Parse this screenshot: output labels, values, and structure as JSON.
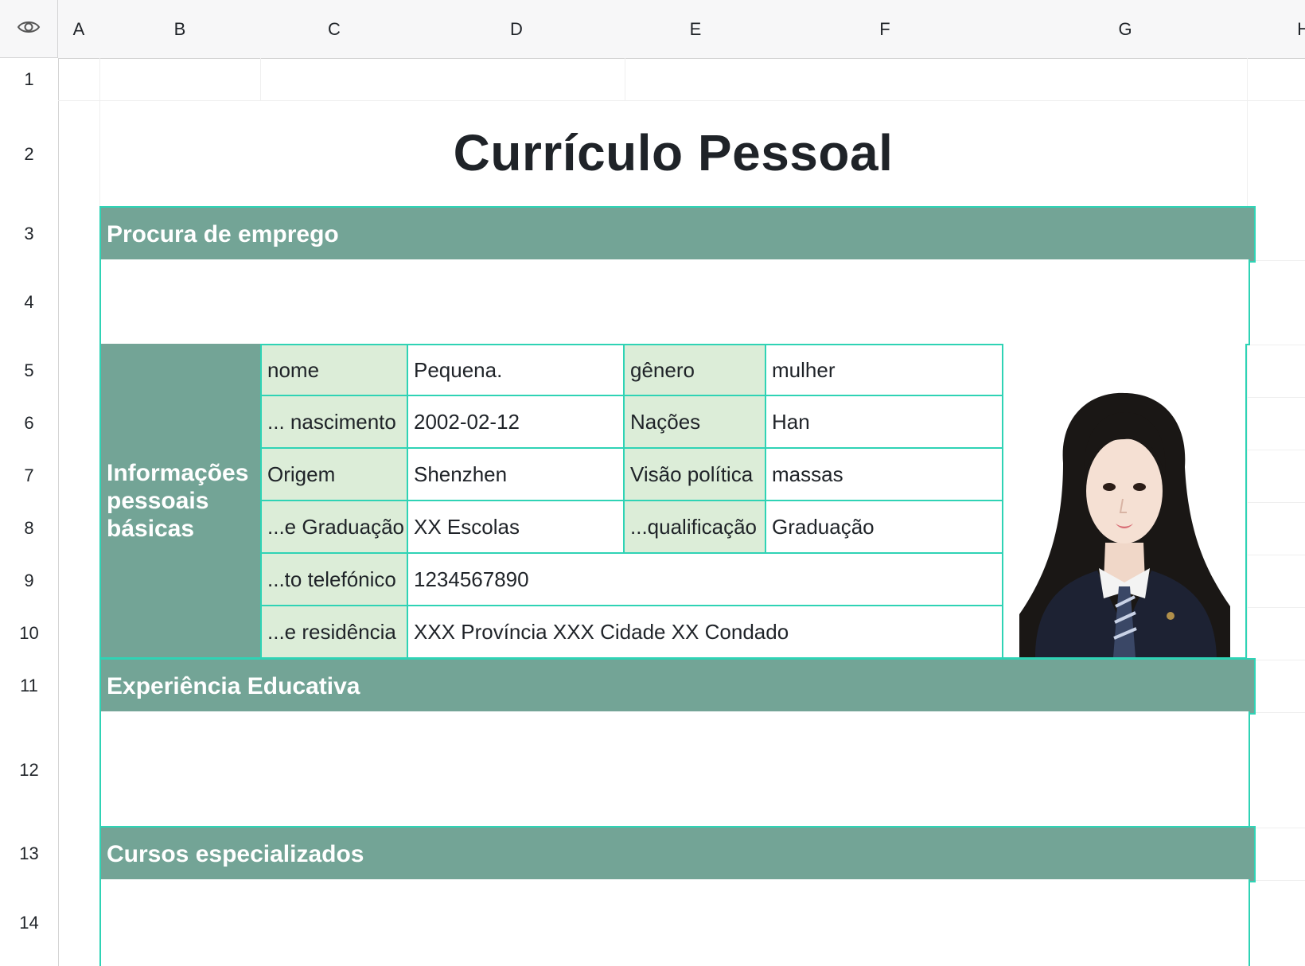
{
  "sheet": {
    "columns": [
      "A",
      "B",
      "C",
      "D",
      "E",
      "F",
      "G",
      "H"
    ],
    "rows": [
      "1",
      "2",
      "3",
      "4",
      "5",
      "6",
      "7",
      "8",
      "9",
      "10",
      "11",
      "12",
      "13",
      "14"
    ],
    "view_icon": "eye-icon"
  },
  "resume": {
    "title": "Currículo Pessoal",
    "section_job": "Procura de emprego",
    "section_basic": "Informações pessoais básicas",
    "section_education": "Experiência Educativa",
    "section_courses": "Cursos especializados",
    "fields": {
      "name_label": "nome",
      "name_value": "Pequena.",
      "gender_label": "gênero",
      "gender_value": "mulher",
      "birth_label": "... nascimento",
      "birth_value": "2002-02-12",
      "nation_label": "Nações",
      "nation_value": "Han",
      "origin_label": "Origem",
      "origin_value": "Shenzhen",
      "politics_label": "Visão política",
      "politics_value": "massas",
      "grad_label": "...e Graduação",
      "grad_value": "XX Escolas",
      "qual_label": "...qualificação",
      "qual_value": "Graduação",
      "phone_label": "...to telefónico",
      "phone_value": "1234567890",
      "address_label": "...e residência",
      "address_value": "XXX Província XXX Cidade XX Condado"
    },
    "photo": "portrait-photo"
  },
  "colors": {
    "band": "#73a496",
    "border": "#2fd3b5",
    "label_fill": "#dcedd8"
  }
}
